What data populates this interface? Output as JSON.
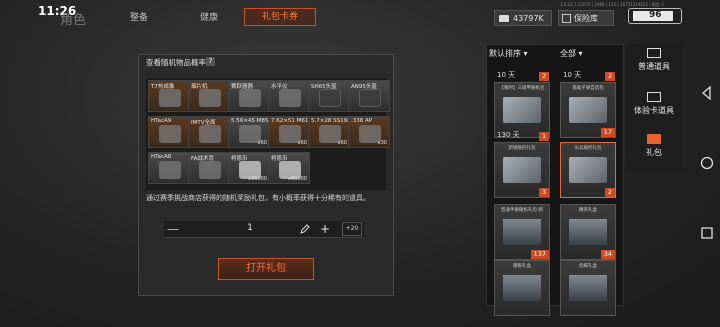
{
  "status": {
    "time": "11:26"
  },
  "header": {
    "back_title": "角色",
    "tabs": [
      "整备",
      "健康",
      "礼包卡券"
    ],
    "version_text": "1.0.16.7.15070 | 2069 | 125 | 16751374632 | 稳定-2",
    "currency_value": "43797K",
    "safe_label": "保险库",
    "battery_level": "96"
  },
  "modal": {
    "title": "查看随机物品概率:",
    "help": "?",
    "items": [
      {
        "name": "T7热成像",
        "count": "",
        "color": "orange"
      },
      {
        "name": "烟片机",
        "count": "",
        "color": "orange"
      },
      {
        "name": "赛跃器器",
        "count": "",
        "color": "gray"
      },
      {
        "name": "水平仪",
        "count": "",
        "color": "gray"
      },
      {
        "name": "SH65头盔",
        "count": "",
        "color": "gray"
      },
      {
        "name": "AN95头盔",
        "count": "",
        "color": "gray"
      },
      {
        "name": "HTacA9",
        "count": "",
        "color": "orange"
      },
      {
        "name": "IMTV全面",
        "count": "",
        "color": "orange"
      },
      {
        "name": "5.56×45 M855",
        "count": "x60",
        "color": "gray"
      },
      {
        "name": "7.62×51 M61",
        "count": "x60",
        "color": "orange"
      },
      {
        "name": "5.7×28 SS198",
        "count": "x60",
        "color": "orange"
      },
      {
        "name": ".338 AP",
        "count": "x30",
        "color": "orange"
      },
      {
        "name": "HTacA8",
        "count": "",
        "color": "gray"
      },
      {
        "name": "FA战术背",
        "count": "",
        "color": "gray"
      },
      {
        "name": "柯恩币",
        "count": "x30000",
        "color": "gray"
      },
      {
        "name": "柯恩币",
        "count": "x60000",
        "color": "gray"
      }
    ],
    "description": "通过赛季挑战商店获得的随机奖励礼包，有小概率获得十分稀有的道具。",
    "quantity": "1",
    "qty_max": "+20",
    "open_button": "打开礼包"
  },
  "inventory": {
    "sort_label": "默认排序",
    "filter_label": "全部",
    "cards": [
      {
        "label": "【限时】三级甲随机包",
        "timer": "10 天",
        "corner": "2",
        "badge": ""
      },
      {
        "label": "基础子弹自选包",
        "timer": "10 天",
        "corner": "2",
        "badge": "17"
      },
      {
        "label": "新锐级控礼包",
        "timer": "130 天",
        "corner": "1",
        "badge": "3"
      },
      {
        "label": "尖兵级控礼包",
        "timer": "",
        "corner": "",
        "badge": "2"
      },
      {
        "label": "普通手册随机礼包-新",
        "timer": "",
        "corner": "",
        "badge": "137"
      },
      {
        "label": "精英礼盒",
        "timer": "",
        "corner": "",
        "badge": "34"
      },
      {
        "label": "随眼礼盒",
        "timer": "",
        "corner": "",
        "badge": ""
      },
      {
        "label": "指挥礼盒",
        "timer": "",
        "corner": "",
        "badge": ""
      }
    ]
  },
  "categories": [
    "普通道具",
    "体验卡道具",
    "礼包"
  ]
}
